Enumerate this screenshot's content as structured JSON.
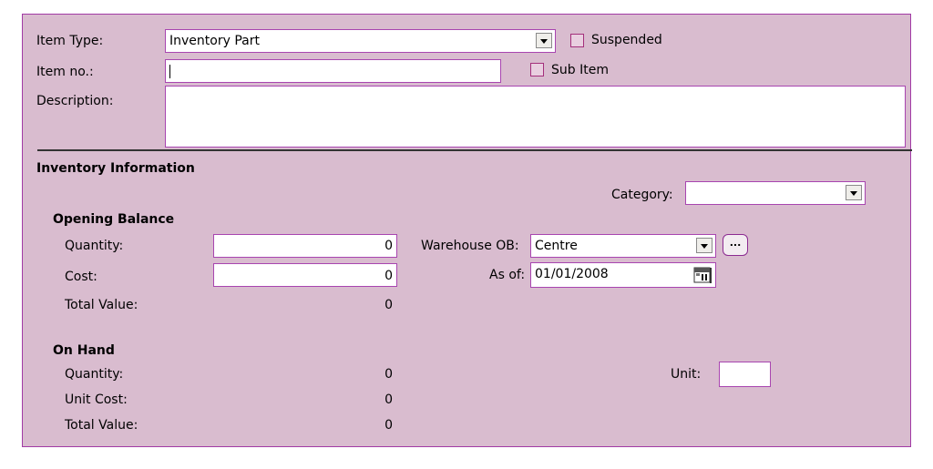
{
  "item": {
    "type_label": "Item Type:",
    "type_value": "Inventory Part",
    "suspended_label": "Suspended",
    "no_label": "Item no.:",
    "no_value": "",
    "sub_item_label": "Sub Item",
    "description_label": "Description:",
    "description_value": ""
  },
  "inventory": {
    "section_title": "Inventory Information",
    "category_label": "Category:",
    "category_value": "",
    "opening": {
      "title": "Opening Balance",
      "quantity_label": "Quantity:",
      "quantity_value": "0",
      "cost_label": "Cost:",
      "cost_value": "0",
      "total_label": "Total Value:",
      "total_value": "0",
      "warehouse_label": "Warehouse OB:",
      "warehouse_value": "Centre",
      "browse_label": "...",
      "asof_label": "As of:",
      "asof_value": "01/01/2008"
    },
    "onhand": {
      "title": "On Hand",
      "quantity_label": "Quantity:",
      "quantity_value": "0",
      "unitcost_label": "Unit Cost:",
      "unitcost_value": "0",
      "total_label": "Total Value:",
      "total_value": "0",
      "unit_label": "Unit:",
      "unit_value": ""
    }
  }
}
